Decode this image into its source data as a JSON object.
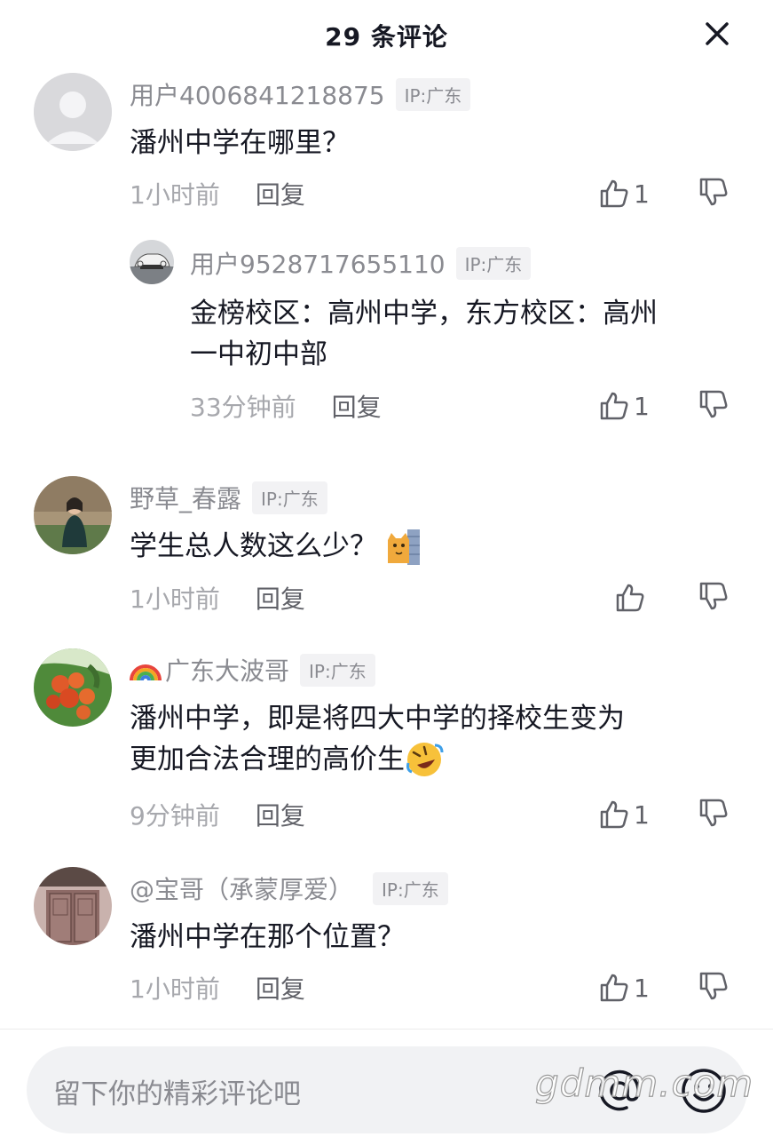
{
  "header": {
    "title": "29 条评论"
  },
  "comments": [
    {
      "author": "用户4006841218875",
      "ip": "IP:广东",
      "text": "潘州中学在哪里？",
      "time": "1小时前",
      "reply_label": "回复",
      "likes": "1",
      "avatar": "default-user-avatar",
      "reply": {
        "author": "用户9528717655110",
        "ip": "IP:广东",
        "text_line1": "金榜校区：高州中学，东方校区：高州",
        "text_line2": "一中初中部",
        "time": "33分钟前",
        "reply_label": "回复",
        "likes": "1",
        "avatar": "car-photo-avatar"
      }
    },
    {
      "author": "野草_春露",
      "ip": "IP:广东",
      "text": "学生总人数这么少？",
      "time": "1小时前",
      "reply_label": "回复",
      "likes": "",
      "avatar": "woman-photo-avatar",
      "emoji": "peeking-cat-emoji"
    },
    {
      "author": "广东大波哥",
      "ip": "IP:广东",
      "text_line1": "潘州中学，即是将四大中学的择校生变为",
      "text_line2": "更加合法合理的高价生",
      "time": "9分钟前",
      "reply_label": "回复",
      "likes": "1",
      "avatar": "fruit-photo-avatar",
      "name_emoji": "rainbow-emoji",
      "emoji": "rolling-laugh-emoji"
    },
    {
      "author": "@宝哥（承蒙厚爱）",
      "ip": "IP:广东",
      "text": "潘州中学在那个位置？",
      "time": "1小时前",
      "reply_label": "回复",
      "likes": "1",
      "avatar": "door-photo-avatar"
    }
  ],
  "input": {
    "placeholder": "留下你的精彩评论吧"
  },
  "watermark": "gdmm.com",
  "icons": [
    "close-icon",
    "thumbs-up-icon",
    "thumbs-down-icon",
    "at-icon",
    "emoji-smile-icon"
  ],
  "colors": {
    "text": "#161823",
    "secondary": "#8a8b91",
    "muted": "#a7a8ad",
    "badge_bg": "#f2f2f4",
    "input_bg": "#f1f2f4"
  }
}
